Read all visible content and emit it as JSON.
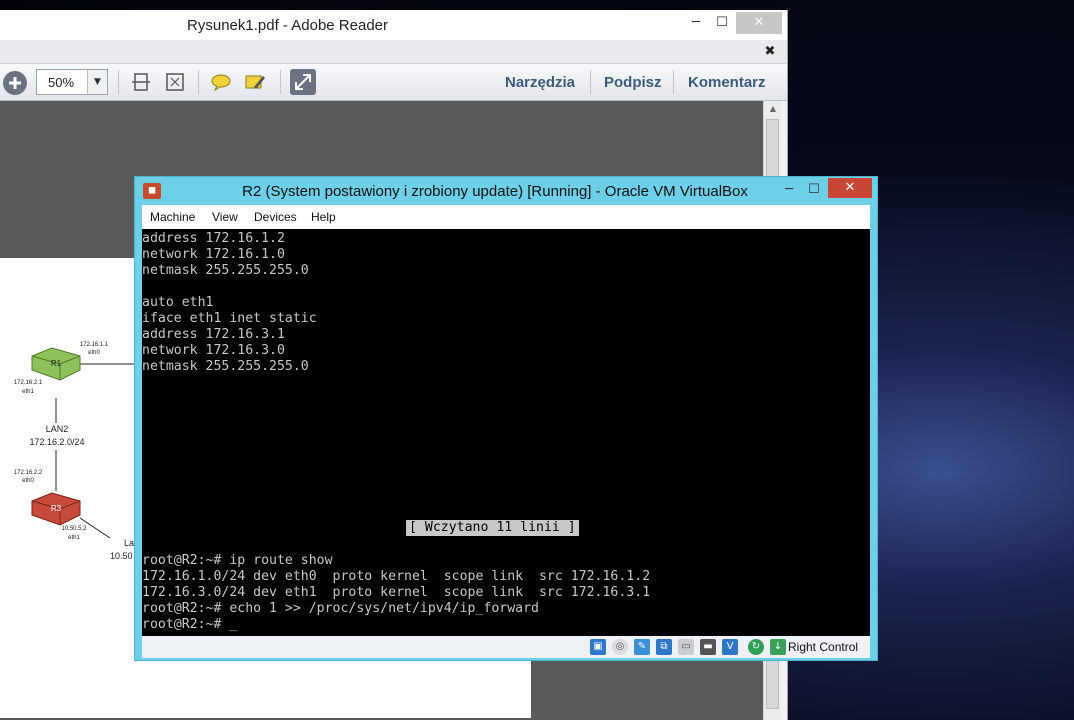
{
  "reader": {
    "title": "Rysunek1.pdf - Adobe Reader",
    "controls": {
      "minimize": "─",
      "maximize": "☐",
      "close": "✕",
      "doc_close": "✖"
    },
    "toolbar": {
      "zoom_value": "50%",
      "links": [
        "Narzędzia",
        "Podpisz",
        "Komentarz"
      ]
    },
    "diagram": {
      "r1": {
        "label": "R1",
        "ip_eth0": "172.16.1.1",
        "if_eth0": "eth0",
        "ip_eth1": "172.16.2.1",
        "if_eth1": "eth1"
      },
      "lan2": {
        "name": "LAN2",
        "subnet": "172.16.2.0/24"
      },
      "r3": {
        "label": "R3",
        "ip_eth0": "172.16.2.2",
        "if_eth0": "eth0",
        "ip_eth1": "10.50.5.2",
        "if_eth1": "eth1"
      },
      "partial_label": "La",
      "partial_ip": "10.50"
    }
  },
  "vbox": {
    "title": "R2 (System postawiony i zrobiony update) [Running] - Oracle VM VirtualBox",
    "menu": [
      "Machine",
      "View",
      "Devices",
      "Help"
    ],
    "controls": {
      "minimize": "─",
      "maximize": "☐",
      "close": "✕"
    },
    "terminal_lines": [
      "address 172.16.1.2",
      "network 172.16.1.0",
      "netmask 255.255.255.0",
      "",
      "auto eth1",
      "iface eth1 inet static",
      "address 172.16.3.1",
      "network 172.16.3.0",
      "netmask 255.255.255.0"
    ],
    "terminal_status": "[ Wczytano 11 linii ]",
    "terminal_bottom": [
      "root@R2:~# ip route show",
      "172.16.1.0/24 dev eth0  proto kernel  scope link  src 172.16.1.2",
      "172.16.3.0/24 dev eth1  proto kernel  scope link  src 172.16.3.1",
      "root@R2:~# echo 1 >> /proc/sys/net/ipv4/ip_forward",
      "root@R2:~# _"
    ],
    "status_text": "Right Control"
  }
}
